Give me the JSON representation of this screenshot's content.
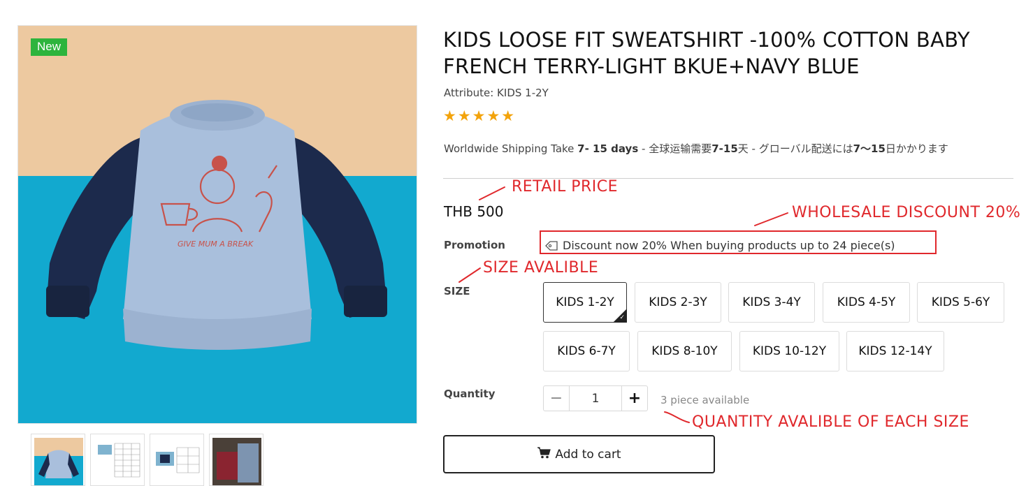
{
  "product": {
    "badge": "New",
    "title": "KIDS LOOSE FIT SWEATSHIRT -100% COTTON BABY FRENCH TERRY-LIGHT BKUE+NAVY BLUE",
    "attribute": "Attribute: KIDS 1-2Y",
    "rating_stars": 5,
    "stars_text": "★★★★★",
    "image_print_text": "GIVE MUM A BREAK"
  },
  "shipping": {
    "part1": "Worldwide Shipping Take ",
    "part2": "7- 15 days",
    "part3": " - 全球运输需要",
    "part4": "7-15",
    "part5": "天 - グローバル配送には",
    "part6": "7〜15",
    "part7": "日かかります"
  },
  "price": "THB 500",
  "promotion": {
    "label": "Promotion",
    "text": "Discount now 20% When buying products up to 24 piece(s)"
  },
  "size": {
    "label": "SIZE",
    "selected": "KIDS 1-2Y",
    "options": [
      "KIDS 1-2Y",
      "KIDS 2-3Y",
      "KIDS 3-4Y",
      "KIDS 4-5Y",
      "KIDS 5-6Y",
      "KIDS 6-7Y",
      "KIDS 8-10Y",
      "KIDS 10-12Y",
      "KIDS 12-14Y"
    ]
  },
  "quantity": {
    "label": "Quantity",
    "value": "1",
    "minus": "−",
    "plus": "+",
    "available": "3 piece available"
  },
  "add_to_cart": "Add to cart",
  "annotations": {
    "retail": "RETAIL PRICE",
    "wholesale": "WHOLESALE DISCOUNT 20%",
    "size": "SIZE AVALIBLE",
    "quantity": "QUANTITY AVALIBLE OF EACH SIZE"
  },
  "colors": {
    "badge": "#2db43d",
    "stars": "#f3a30b",
    "annotation": "#e0282c",
    "sweater_light": "#a9bfdc",
    "sweater_navy": "#1c2a4c",
    "print": "#c8524a"
  },
  "icons": {
    "promo": "tag-icon",
    "cart": "shopping-cart-icon",
    "selected": "check-icon"
  }
}
